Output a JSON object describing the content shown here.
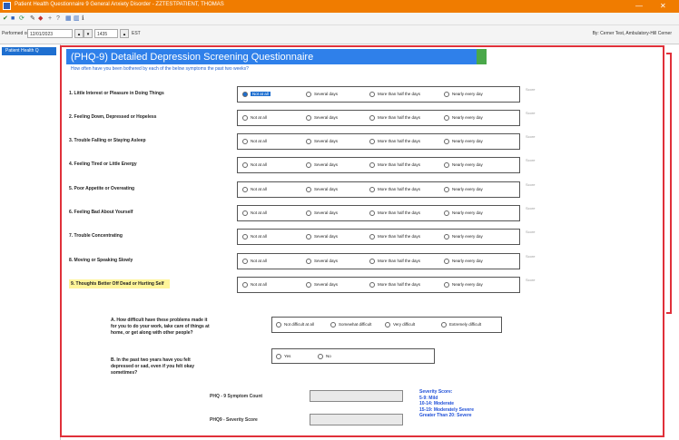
{
  "window": {
    "title": "Patient Health Questionnaire 9 General Anxiety Disorder - ZZTESTPATIENT, THOMAS",
    "minimize_glyph": "—",
    "close_glyph": "✕"
  },
  "toolbar": {
    "icons": [
      "checkmark-icon",
      "save-icon",
      "refresh-icon",
      "edit-icon",
      "print-icon",
      "add-icon",
      "help-icon",
      "grid-icon",
      "split-icon",
      "info-icon"
    ]
  },
  "perf": {
    "label": "Performed on:",
    "date": "12/01/2023",
    "time": "1435",
    "timezone": "EST",
    "by": "By:  Cerner Test, Ambulatory-Hill Cerner"
  },
  "nav": {
    "tab_label": "Patient Health Q"
  },
  "form": {
    "title": "(PHQ-9) Detailed Depression Screening Questionnaire",
    "subtitle": "How often have you been bothered by each of the below symptoms the past two weeks?",
    "options": [
      "Not at all",
      "Several days",
      "More than half the days",
      "Nearly every day"
    ],
    "note": "Score",
    "questions": [
      {
        "label": "1. Little Interest or Pleasure in Doing Things",
        "selected": 0
      },
      {
        "label": "2. Feeling Down, Depressed or Hopeless",
        "selected": -1
      },
      {
        "label": "3. Trouble Falling or Staying Asleep",
        "selected": -1
      },
      {
        "label": "4. Feeling Tired or Little Energy",
        "selected": -1
      },
      {
        "label": "5. Poor Appetite or Overeating",
        "selected": -1
      },
      {
        "label": "6. Feeling Bad About Yourself",
        "selected": -1
      },
      {
        "label": "7. Trouble Concentrating",
        "selected": -1
      },
      {
        "label": "8. Moving or Speaking Slowly",
        "selected": -1
      },
      {
        "label": "9. Thoughts Better Off Dead or Hurting Self",
        "selected": -1,
        "highlight": true
      }
    ],
    "difficulty": {
      "label_lines": [
        "A. How difficult have these problems made it",
        "for you to do your work, take care of things at",
        "home, or get along with other people?"
      ],
      "options": [
        "Not difficult at all",
        "Somewhat difficult",
        "Very difficult",
        "Extremely difficult"
      ]
    },
    "depressed": {
      "label_lines": [
        "B. In the past two years have you felt",
        "depressed or sad, even if you felt okay",
        "sometimes?"
      ],
      "options": [
        "Yes",
        "No"
      ]
    },
    "symptom_count_label": "PHQ - 9 Symptom Count",
    "severity_score_label": "PHQ9 - Severity Score",
    "severity_lines": [
      "Severity Score:",
      "5-9: Mild",
      "10-14: Moderate",
      "15-19: Moderately Severe",
      "Greater Than 20: Severe"
    ]
  }
}
